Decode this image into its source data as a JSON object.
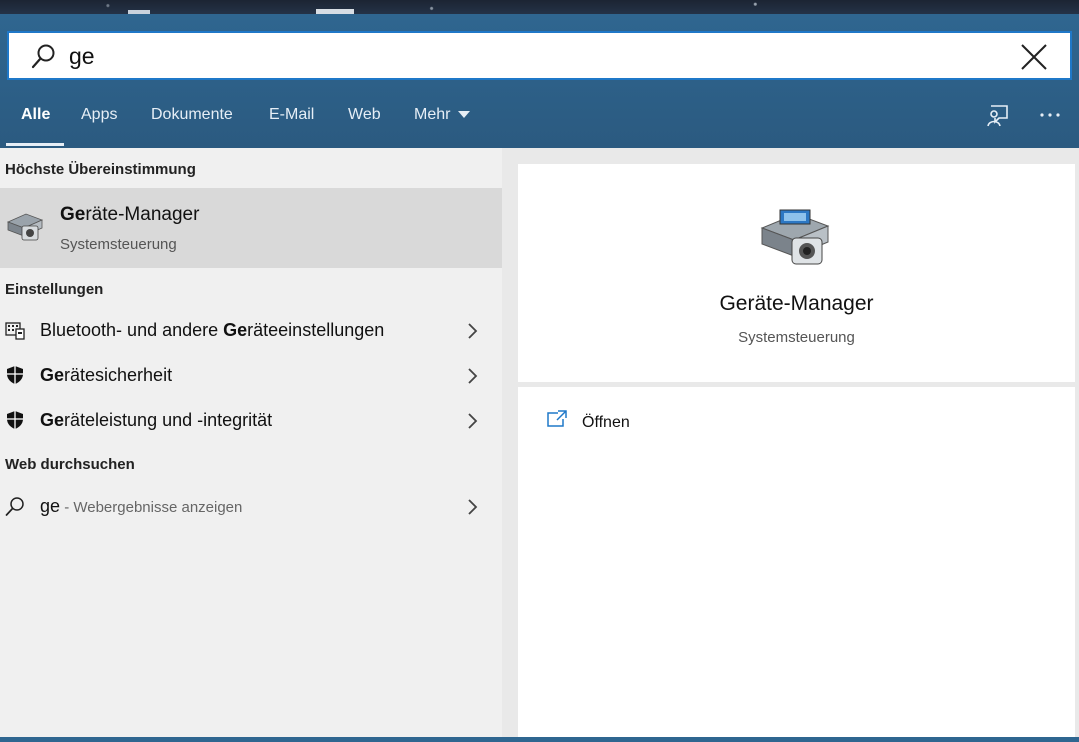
{
  "search": {
    "query": "ge"
  },
  "tabs": [
    {
      "label": "Alle"
    },
    {
      "label": "Apps"
    },
    {
      "label": "Dokumente"
    },
    {
      "label": "E-Mail"
    },
    {
      "label": "Web"
    },
    {
      "label": "Mehr"
    }
  ],
  "left": {
    "best_match_title": "Höchste Übereinstimmung",
    "best_match": {
      "title_bold": "Ge",
      "title_rest": "räte-Manager",
      "subtitle": "Systemsteuerung"
    },
    "settings_title": "Einstellungen",
    "settings_items": [
      {
        "before": "Bluetooth- und andere ",
        "bold": "Ge",
        "after": "räteeinstellungen"
      },
      {
        "before": "",
        "bold": "Ge",
        "after": "rätesicherheit"
      },
      {
        "before": "",
        "bold": "Ge",
        "after": "räteleistung und -integrität"
      }
    ],
    "web_title": "Web durchsuchen",
    "web_item": {
      "query": "ge",
      "suffix": " - Webergebnisse anzeigen"
    }
  },
  "preview": {
    "title": "Geräte-Manager",
    "subtitle": "Systemsteuerung",
    "action_open": "Öffnen"
  },
  "icons": [
    "search-icon",
    "close-icon",
    "feedback-icon",
    "more-options-icon",
    "device-manager-icon",
    "keyboard-settings-icon",
    "shield-icon",
    "chevron-right-icon",
    "open-external-icon"
  ],
  "colors": {
    "header": "#2f6690",
    "accent": "#1f78c8",
    "list_bg": "#f0f0f0",
    "selected": "#d9d9d9"
  }
}
